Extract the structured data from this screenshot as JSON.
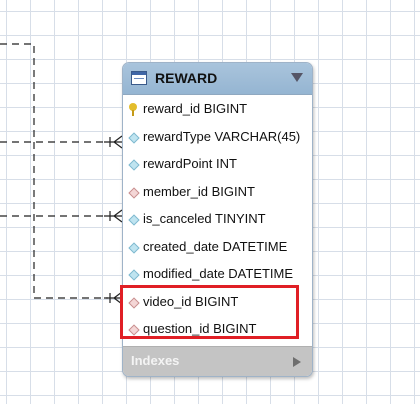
{
  "table": {
    "title": "REWARD",
    "columns": [
      {
        "text": "reward_id BIGINT",
        "icon": "key-icon"
      },
      {
        "text": "rewardType VARCHAR(45)",
        "icon": "column-diamond-icon"
      },
      {
        "text": "rewardPoint INT",
        "icon": "column-diamond-icon"
      },
      {
        "text": "member_id BIGINT",
        "icon": "foreign-key-diamond-icon"
      },
      {
        "text": "is_canceled TINYINT",
        "icon": "column-diamond-icon"
      },
      {
        "text": "created_date DATETIME",
        "icon": "column-diamond-icon"
      },
      {
        "text": "modified_date DATETIME",
        "icon": "column-diamond-icon"
      },
      {
        "text": "video_id BIGINT",
        "icon": "foreign-key-diamond-icon"
      },
      {
        "text": "question_id BIGINT",
        "icon": "foreign-key-diamond-icon"
      }
    ],
    "indexes_label": "Indexes"
  },
  "colors": {
    "header": "#a9c4dc",
    "highlight": "#e01f25",
    "key": "#e3bd2c",
    "column_diamond": "#bfe4f0",
    "foreign_key_diamond": "#f4d6d6",
    "grid": "#d7dee8"
  }
}
